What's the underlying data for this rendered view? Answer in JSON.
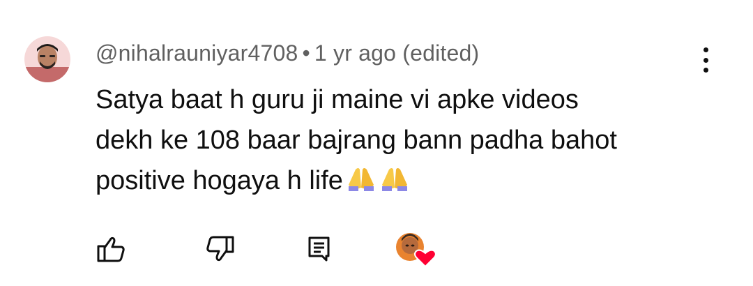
{
  "comment": {
    "author": "@nihalrauniyar4708",
    "separator": "•",
    "timestamp": "1 yr ago (edited)",
    "text_line1": "Satya baat h guru ji maine vi apke videos",
    "text_line2": "dekh ke 108 baar bajrang bann padha bahot",
    "text_line3": "positive hogaya h life",
    "emoji": "🙏🙏"
  },
  "actions": {
    "like_icon": "thumbs-up-outline",
    "dislike_icon": "thumbs-down-outline",
    "reply_icon": "comment-reply",
    "creator_heart": "creator-heart-avatar"
  },
  "colors": {
    "meta_text": "#606060",
    "body_text": "#0f0f0f",
    "heart": "#ff0033"
  }
}
